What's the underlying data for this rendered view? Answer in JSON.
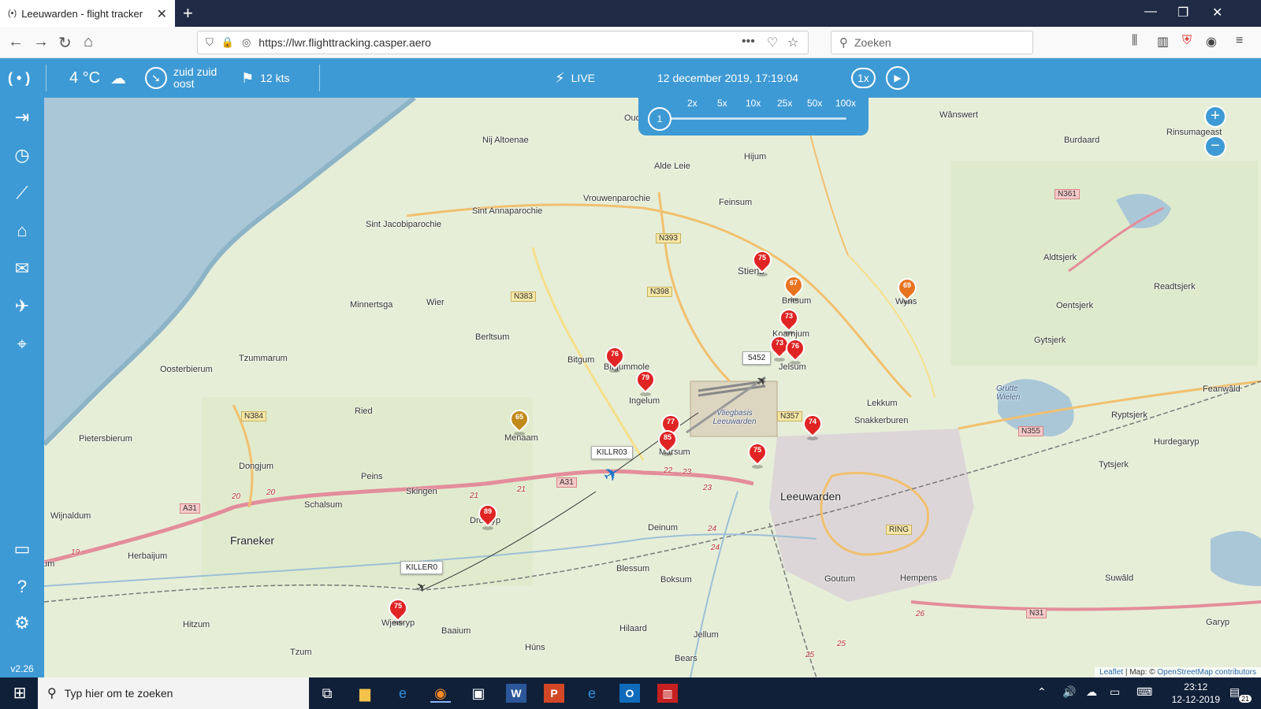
{
  "browser": {
    "tab_title": "Leeuwarden - flight tracker",
    "tab_icon": "(•)",
    "url": "https://lwr.flighttracking.casper.aero",
    "search_placeholder": "Zoeken"
  },
  "header": {
    "temperature": "4 °C",
    "wind_direction": "zuid zuid oost",
    "wind_speed": "12 kts",
    "live_label": "LIVE",
    "datetime": "12 december 2019, 17:19:04",
    "speed_current": "1x",
    "colors": {
      "accent": "#3e9ad5",
      "marker_red": "#e02424",
      "marker_orange": "#e8731f",
      "marker_olive": "#c08a1a"
    }
  },
  "speed_panel": {
    "options": [
      "2x",
      "5x",
      "10x",
      "25x",
      "50x",
      "100x"
    ],
    "slider_value_label": "1"
  },
  "sidebar": {
    "icons": [
      "login-icon",
      "clock-icon",
      "chart-icon",
      "home-icon",
      "mail-icon",
      "plane-icon",
      "location-icon",
      "chat-icon",
      "help-icon",
      "settings-icon"
    ],
    "version": "v2.26"
  },
  "map": {
    "places": [
      {
        "name": "Nij Altoenae"
      },
      {
        "name": "Alde Leie"
      },
      {
        "name": "Hijum"
      },
      {
        "name": "Wânswert"
      },
      {
        "name": "Burdaard"
      },
      {
        "name": "Rinsumageast"
      },
      {
        "name": "Vrouwenparochie"
      },
      {
        "name": "Sint Annaparochie"
      },
      {
        "name": "Sint Jacobiparochie"
      },
      {
        "name": "Feinsum"
      },
      {
        "name": "Stiens"
      },
      {
        "name": "Britsum"
      },
      {
        "name": "Wyns"
      },
      {
        "name": "Aldtsjerk"
      },
      {
        "name": "Oentsjerk"
      },
      {
        "name": "Readtsjerk"
      },
      {
        "name": "Minnertsga"
      },
      {
        "name": "Wier"
      },
      {
        "name": "Berltsum"
      },
      {
        "name": "Bitgum"
      },
      {
        "name": "Bitgummole"
      },
      {
        "name": "Koarnjum"
      },
      {
        "name": "Jelsum"
      },
      {
        "name": "Gytsjerk"
      },
      {
        "name": "Oosterbierum"
      },
      {
        "name": "Tzummarum"
      },
      {
        "name": "Ingelum"
      },
      {
        "name": "Lekkum"
      },
      {
        "name": "Feanwâld"
      },
      {
        "name": "Grutte Wielen"
      },
      {
        "name": "Snakkerburen"
      },
      {
        "name": "Ryptsjerk"
      },
      {
        "name": "Ried"
      },
      {
        "name": "Menaam"
      },
      {
        "name": "Marsum"
      },
      {
        "name": "Hurdegaryp"
      },
      {
        "name": "Pietersbierum"
      },
      {
        "name": "Dongjum"
      },
      {
        "name": "Peins"
      },
      {
        "name": "Tytsjerk"
      },
      {
        "name": "Skingen"
      },
      {
        "name": "Leeuwarden"
      },
      {
        "name": "Schalsum"
      },
      {
        "name": "Wijnaldum"
      },
      {
        "name": "Dronryp"
      },
      {
        "name": "Deinum"
      },
      {
        "name": "Franeker"
      },
      {
        "name": "Herbaijum"
      },
      {
        "name": "Blessum"
      },
      {
        "name": "Boksum"
      },
      {
        "name": "Goutum"
      },
      {
        "name": "Hempens"
      },
      {
        "name": "Suwâld"
      },
      {
        "name": "Hitzum"
      },
      {
        "name": "Wjelsryp"
      },
      {
        "name": "Baaium"
      },
      {
        "name": "Hilaard"
      },
      {
        "name": "Jellum"
      },
      {
        "name": "Garyp"
      },
      {
        "name": "Tzum"
      },
      {
        "name": "Húns"
      },
      {
        "name": "Bears"
      },
      {
        "name": "Midlum"
      },
      {
        "name": "Vliegbasis Leeuwarden"
      },
      {
        "name": "Oude"
      }
    ],
    "road_labels": [
      "N393",
      "N398",
      "N383",
      "N384",
      "N357",
      "N361",
      "N355",
      "N31",
      "A31",
      "A31",
      "RING"
    ],
    "km_markers": [
      "19",
      "20",
      "20",
      "21",
      "21",
      "22",
      "23",
      "23",
      "24",
      "24",
      "25",
      "25",
      "26"
    ],
    "markers": [
      {
        "num": "75",
        "color": "red"
      },
      {
        "num": "67",
        "color": "orange"
      },
      {
        "num": "69",
        "color": "orange"
      },
      {
        "num": "73",
        "color": "red"
      },
      {
        "num": "73",
        "color": "red"
      },
      {
        "num": "76",
        "color": "red"
      },
      {
        "num": "76",
        "color": "red"
      },
      {
        "num": "79",
        "color": "red"
      },
      {
        "num": "65",
        "color": "olive"
      },
      {
        "num": "77",
        "color": "red"
      },
      {
        "num": "85",
        "color": "red"
      },
      {
        "num": "74",
        "color": "red"
      },
      {
        "num": "75",
        "color": "red"
      },
      {
        "num": "89",
        "color": "red"
      },
      {
        "num": "75",
        "color": "red"
      }
    ],
    "flights": [
      "KILLR03",
      "KILLER0",
      "5452"
    ],
    "attribution": {
      "leaflet": "Leaflet",
      "sep": " | Map: © ",
      "osm": "OpenStreetMap contributors"
    }
  },
  "taskbar": {
    "search_placeholder": "Typ hier om te zoeken",
    "time": "23:12",
    "date": "12-12-2019",
    "notifications": "21"
  }
}
